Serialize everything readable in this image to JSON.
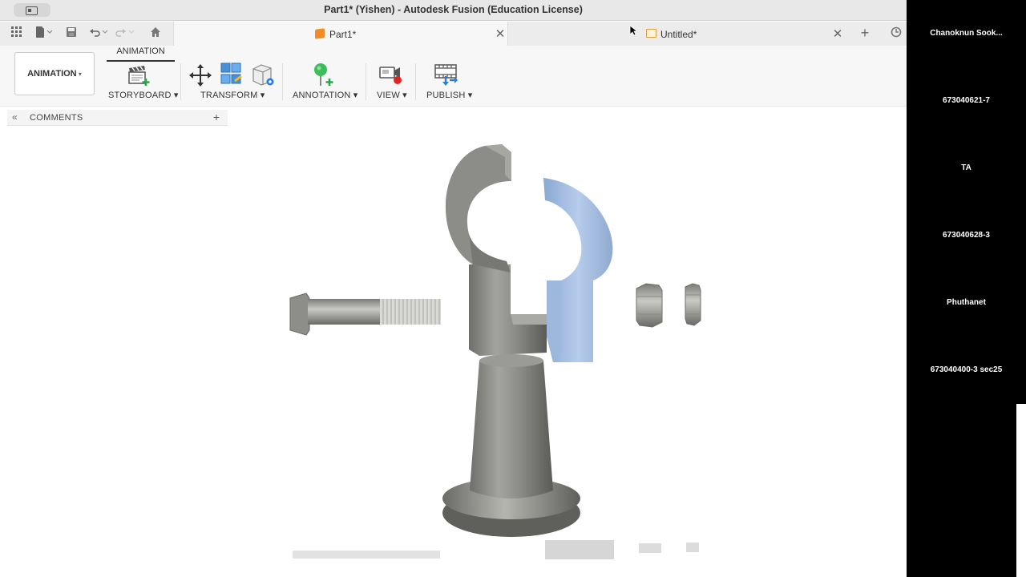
{
  "window": {
    "title": "Part1* (Yishen) - Autodesk Fusion (Education License)"
  },
  "tabs": [
    {
      "label": "Part1*",
      "active": true
    },
    {
      "label": "Untitled*",
      "active": false
    }
  ],
  "toolbar": {
    "workspace": "ANIMATION",
    "workspace_tab": "ANIMATION",
    "groups": [
      "STORYBOARD",
      "TRANSFORM",
      "ANNOTATION",
      "VIEW",
      "PUBLISH"
    ]
  },
  "comments": {
    "label": "COMMENTS"
  },
  "participants": [
    "Chanoknun  Sook...",
    "673040621-7",
    "TA",
    "673040628-3",
    "Phuthanet",
    "673040400-3 sec25"
  ],
  "colors": {
    "accent_blue": "#9db8dc",
    "part_gray": "#8a8a86",
    "orange": "#f28c28"
  }
}
